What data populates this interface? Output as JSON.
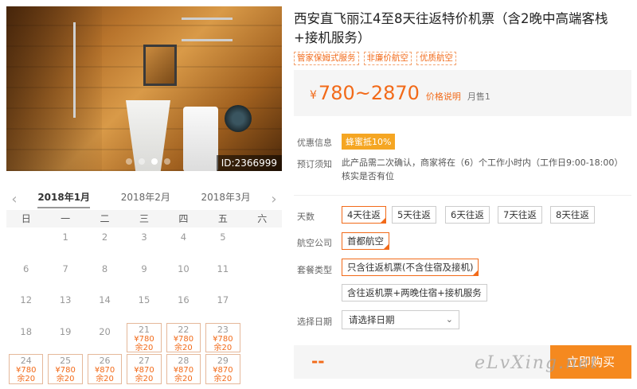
{
  "photo": {
    "id_label": "ID:2366999",
    "dot_count": 4,
    "active_dot": 2
  },
  "calendar": {
    "months": [
      "2018年1月",
      "2018年2月",
      "2018年3月"
    ],
    "active_month": 0,
    "weekdays": [
      "日",
      "一",
      "二",
      "三",
      "四",
      "五",
      "六"
    ],
    "cells": [
      {
        "day": ""
      },
      {
        "day": "1"
      },
      {
        "day": "2"
      },
      {
        "day": "3"
      },
      {
        "day": "4"
      },
      {
        "day": "5"
      },
      {
        "day": ""
      },
      {
        "day": "6"
      },
      {
        "day": "7"
      },
      {
        "day": "8"
      },
      {
        "day": "9"
      },
      {
        "day": "10"
      },
      {
        "day": "11"
      },
      {
        "day": ""
      },
      {
        "day": "12"
      },
      {
        "day": "13"
      },
      {
        "day": "14"
      },
      {
        "day": "15"
      },
      {
        "day": "16"
      },
      {
        "day": "17"
      },
      {
        "day": ""
      },
      {
        "day": "18"
      },
      {
        "day": "19"
      },
      {
        "day": "20"
      },
      {
        "day": "21",
        "price": "¥780",
        "stock": "余20"
      },
      {
        "day": "22",
        "price": "¥780",
        "stock": "余20"
      },
      {
        "day": "23",
        "price": "¥780",
        "stock": "余20"
      },
      {
        "day": ""
      },
      {
        "day": "24",
        "price": "¥780",
        "stock": "余20"
      },
      {
        "day": "25",
        "price": "¥780",
        "stock": "余20"
      },
      {
        "day": "26",
        "price": "¥870",
        "stock": "余20"
      },
      {
        "day": "27",
        "price": "¥870",
        "stock": "余20"
      },
      {
        "day": "28",
        "price": "¥870",
        "stock": "余20"
      },
      {
        "day": "29",
        "price": "¥870",
        "stock": "余20"
      },
      {
        "day": ""
      }
    ]
  },
  "product": {
    "title": "西安直飞丽江4至8天往返特价机票（含2晚中高端客栈+接机服务）",
    "tags": [
      "管家保姆式服务",
      "非廉价航空",
      "优质航空"
    ],
    "currency": "¥",
    "price_range": "780~2870",
    "price_note": "价格说明",
    "monthly_sales": "月售1"
  },
  "info": {
    "promo_label": "优惠信息",
    "promo_badge": "蜂蜜抵10%",
    "notice_label": "预订须知",
    "notice_text": "此产品需二次确认，商家将在（6）个工作小时内（工作日9:00-18:00）核实是否有位"
  },
  "options": {
    "days_label": "天数",
    "days": [
      "4天往返",
      "5天往返",
      "6天往返",
      "7天往返",
      "8天往返"
    ],
    "days_selected": 0,
    "airline_label": "航空公司",
    "airline": "首都航空",
    "package_label": "套餐类型",
    "package_1": "只含往返机票(不含住宿及接机)",
    "package_2": "含往返机票+两晚住宿+接机服务",
    "date_label": "选择日期",
    "date_placeholder": "请选择日期"
  },
  "footer": {
    "price_placeholder": "--",
    "buy_label": "立即购买",
    "watermark": "eLvXing.net"
  },
  "colors": {
    "accent": "#f26a19",
    "button": "#f5891f"
  }
}
